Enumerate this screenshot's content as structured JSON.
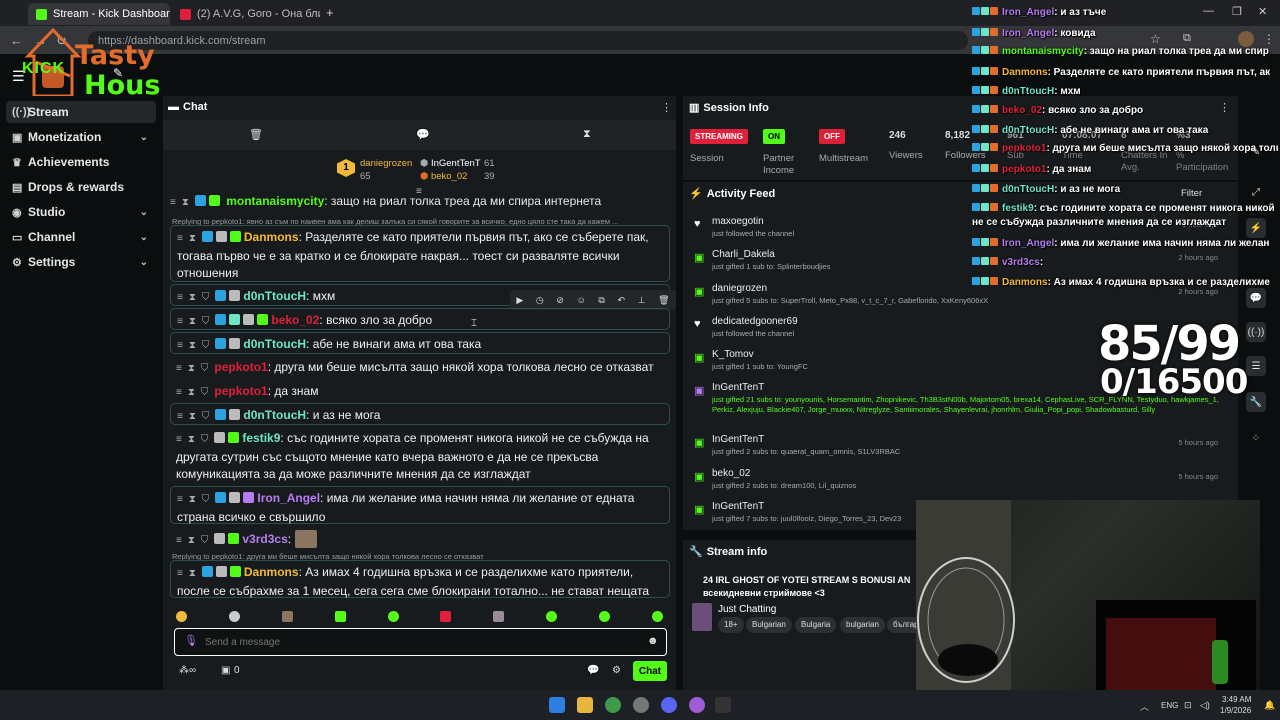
{
  "browser": {
    "tabs": [
      {
        "title": "Stream - Kick Dashboard",
        "active": true
      },
      {
        "title": "(2) A.V.G, Goro - Она близко (",
        "active": false
      }
    ],
    "url": "https://dashboard.kick.com/stream"
  },
  "logo": {
    "line1": "Tasty",
    "line2": "Hous",
    "brand": "KICK"
  },
  "sidebar": {
    "items": [
      {
        "label": "Stream",
        "icon": "stream-icon",
        "active": true,
        "chevron": false
      },
      {
        "label": "Monetization",
        "icon": "monetization-icon",
        "active": false,
        "chevron": true
      },
      {
        "label": "Achievements",
        "icon": "trophy-icon",
        "active": false,
        "chevron": false
      },
      {
        "label": "Drops & rewards",
        "icon": "gift-icon",
        "active": false,
        "chevron": false
      },
      {
        "label": "Studio",
        "icon": "studio-icon",
        "active": false,
        "chevron": true
      },
      {
        "label": "Channel",
        "icon": "channel-icon",
        "active": false,
        "chevron": true
      },
      {
        "label": "Settings",
        "icon": "gear-icon",
        "active": false,
        "chevron": true
      }
    ]
  },
  "chat": {
    "title": "Chat",
    "leaders": [
      {
        "name": "daniegrozen",
        "count": "65"
      },
      {
        "name": "InGentTenT",
        "count": "61"
      },
      {
        "name": "beko_02",
        "count": "39"
      }
    ],
    "top_partial": {
      "name": "montanaismycity",
      "text": ": защо на риал толка треа да ми спира интернета"
    },
    "messages": [
      {
        "reply": "Replying to pepkoto1: явно аз съм по наивен ама как делиш залъка си сякой говорите за всичко, едно цяло сте така да кажем ...",
        "name": "Danmons",
        "color": "#f2b93b",
        "text": ": Разделяте се като приятели първия път, ако се съберете пак, тогава първо че е за кратко и се блокирате накрая... тоест си разваляте всички отношения",
        "boxed": true
      },
      {
        "name": "d0nTtoucH",
        "color": "#6ee6c6",
        "text": ": мхм",
        "boxed": true
      },
      {
        "name": "beko_02",
        "color": "#e0203b",
        "text": ": всяко зло за добро",
        "boxed": true
      },
      {
        "name": "d0nTtoucH",
        "color": "#6ee6c6",
        "text": ": абе не винаги ама ит ова така",
        "boxed": true
      },
      {
        "name": "pepkoto1",
        "color": "#e0203b",
        "text": ": друга ми беше мисълта защо някой хора толкова лесно се отказват",
        "boxed": false
      },
      {
        "name": "pepkoto1",
        "color": "#e0203b",
        "text": ": да знам",
        "boxed": false
      },
      {
        "name": "d0nTtoucH",
        "color": "#6ee6c6",
        "text": ": и аз не мога",
        "boxed": true
      },
      {
        "name": "festik9",
        "color": "#6ee6c6",
        "text": ": със годините хората се променят никога никой не се събужда на другата сутрин със същото мнение като вчера важното е да не се прекъсва комуникацията за да може различните мнения да се изглаждат",
        "boxed": false
      },
      {
        "name": "Iron_Angel",
        "color": "#b77cf2",
        "text": ": има ли желание има начин няма ли желание от едната страна всичко е свършило",
        "boxed": true
      },
      {
        "name": "v3rd3cs",
        "color": "#b77cf2",
        "text": ":",
        "boxed": false
      },
      {
        "reply": "Replying to pepkoto1: друга ми беше мисълта защо някой хора толкова лесно се отказват",
        "name": "Danmons",
        "color": "#f2b93b",
        "text": ": Аз имах 4 годишна връзка и се разделихме като приятели, после се събрахме за 1 месец, сега сега сме блокирани тотално... не стават нещата",
        "boxed": true
      }
    ],
    "input_placeholder": "Send a message",
    "chat_button": "Chat",
    "points": "0"
  },
  "session": {
    "title": "Session Info",
    "badges": [
      {
        "text": "STREAMING",
        "label": "Session",
        "color": "#e0203b"
      },
      {
        "text": "ON",
        "label": "Partner Income",
        "color": "#53fc18"
      },
      {
        "text": "OFF",
        "label": "Multistream",
        "color": "#e0203b"
      }
    ],
    "stats": [
      {
        "value": "246",
        "label": "Viewers"
      },
      {
        "value": "8,182",
        "label": "Followers"
      },
      {
        "value": "961",
        "label": "Sub"
      },
      {
        "value": "07:08:07",
        "label": "Time"
      },
      {
        "value": "8",
        "label": "Chatters In Avg."
      },
      {
        "value": "%3",
        "label": "% Participation"
      }
    ]
  },
  "activity": {
    "title": "Activity Feed",
    "filter": "Filter",
    "items": [
      {
        "icon": "heart-icon",
        "name": "maxoegotin",
        "sub": "just followed the channel",
        "time": "1 hour ago"
      },
      {
        "icon": "gift-icon",
        "name": "Charli_Dakela",
        "sub": "just gifted 1 sub to: Splinterboudjies",
        "time": "2 hours ago"
      },
      {
        "icon": "gift-icon",
        "name": "daniegrozen",
        "sub": "just gifted 5 subs to: SuperTroll, Meto_Px88, v_t_c_7_r, Gabeflorido, XxKeny606xX",
        "time": "2 hours ago"
      },
      {
        "icon": "heart-icon",
        "name": "dedicatedgooner69",
        "sub": "just followed the channel",
        "time": ""
      },
      {
        "icon": "gift-icon",
        "name": "K_Tomov",
        "sub": "just gifted 1 sub to: YoungFC",
        "time": ""
      },
      {
        "icon": "gift-icon",
        "name": "InGentTenT",
        "sub": "just gifted 21 subs to: younyounis, Horsemantim, Zhopnikevic, Th3B3stN00b, Majortom05, brexa14, CephasLive, SCR_FLYNN, Testyduo, hawkjames_1, Perkiz, Alexjuju, Blackie407, Jorge_muxxx, Nitreglyze, Santiimorales, Shayenlevrai, jhonrhlm, Giulia_Popi_popi, Shadowbasturd, Silly",
        "time": ""
      },
      {
        "icon": "gift-icon",
        "name": "InGentTenT",
        "sub": "just gifted 2 subs to: quaerat_quam_omnis, S1LV3RBAC",
        "time": "5 hours ago"
      },
      {
        "icon": "gift-icon",
        "name": "beko_02",
        "sub": "just gifted 2 subs to: dream100, Lil_quiznos",
        "time": "5 hours ago"
      },
      {
        "icon": "gift-icon",
        "name": "InGentTenT",
        "sub": "just gifted 7 subs to: juul0lfoolz, Diego_Torres_23, Dev23",
        "time": ""
      }
    ]
  },
  "stream_info": {
    "title": "Stream info",
    "stream_title": "24 IRL GHOST OF YOTEI STREAM S BONUSI AN всекидневни стриймове <3",
    "category": "Just Chatting",
    "tags": [
      "18+",
      "Bulgarian",
      "Bulgaria",
      "bulgarian",
      "българ"
    ]
  },
  "overlay": {
    "goal_top": "85/99",
    "goal_bottom": "0/16500",
    "messages": [
      {
        "name": "Iron_Angel",
        "color": "#b77cf2",
        "text": ": и аз тъче"
      },
      {
        "name": "Iron_Angel",
        "color": "#b77cf2",
        "text": ": ковида"
      },
      {
        "name": "montanaismycity",
        "color": "#53fc18",
        "text": ": защо на риал толка треа да ми спир"
      },
      {
        "name": "Danmons",
        "color": "#f2b93b",
        "text": ": Разделяте се като приятели първия път, ак"
      },
      {
        "name": "d0nTtoucH",
        "color": "#6ee6c6",
        "text": ": мхм"
      },
      {
        "name": "beko_02",
        "color": "#e0203b",
        "text": ": всяко зло за добро"
      },
      {
        "name": "d0nTtoucH",
        "color": "#6ee6c6",
        "text": ": абе не винаги ама ит ова така"
      },
      {
        "name": "pepkoto1",
        "color": "#e0203b",
        "text": ": друга ми беше мисълта защо някой хора толкова"
      },
      {
        "name": "pepkoto1",
        "color": "#e0203b",
        "text": ": да знам"
      },
      {
        "name": "d0nTtoucH",
        "color": "#6ee6c6",
        "text": ": и аз не мога"
      },
      {
        "name": "festik9",
        "color": "#6ee6c6",
        "text": ": със годините хората се променят никога никой не се събужда различните мнения да се изглаждат"
      },
      {
        "name": "Iron_Angel",
        "color": "#b77cf2",
        "text": ": има ли желание има начин няма ли желан"
      },
      {
        "name": "v3rd3cs",
        "color": "#b77cf2",
        "text": ":"
      },
      {
        "name": "Danmons",
        "color": "#f2b93b",
        "text": ": Аз имах 4 годишна връзка и се разделихме"
      }
    ]
  },
  "taskbar": {
    "lang": "ENG",
    "time": "3:49 AM",
    "date": "1/9/2026"
  },
  "colors": {
    "accent": "#53fc18",
    "panel": "#181b1d",
    "bg": "#0b0e0f"
  }
}
